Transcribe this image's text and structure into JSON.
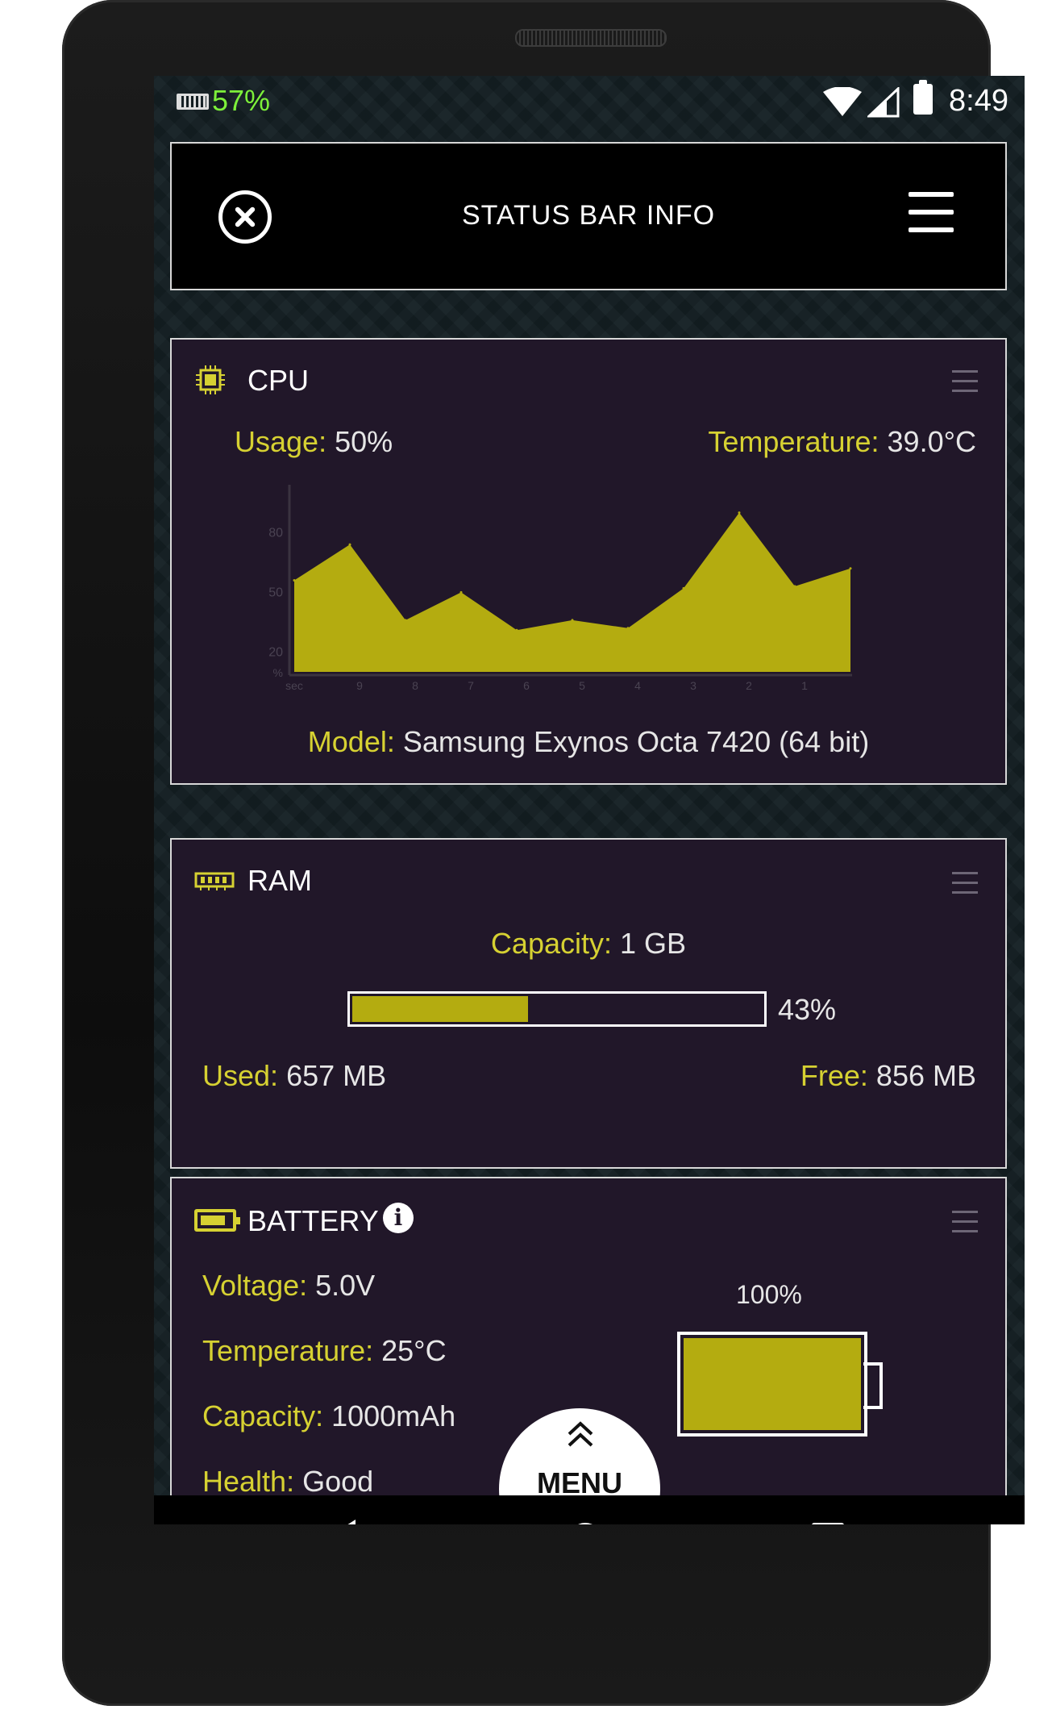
{
  "status_bar": {
    "ram_percent": "57%",
    "time": "8:49",
    "icons": [
      "ram-icon",
      "wifi-icon",
      "signal-icon",
      "battery-icon"
    ]
  },
  "app_bar": {
    "title": "STATUS BAR INFO",
    "close_icon": "close-circle-icon",
    "menu_icon": "hamburger-menu-icon"
  },
  "cpu": {
    "title": "CPU",
    "usage_label": "Usage:",
    "usage_value": "50%",
    "temperature_label": "Temperature:",
    "temperature_value": "39.0°C",
    "model_label": "Model:",
    "model_value": "Samsung Exynos Octa 7420 (64 bit)"
  },
  "chart_data": {
    "type": "area",
    "x": [
      "sec",
      "9",
      "8",
      "7",
      "6",
      "5",
      "4",
      "3",
      "2",
      "1"
    ],
    "values": [
      56,
      74,
      36,
      50,
      31,
      36,
      32,
      52,
      90,
      53,
      62
    ],
    "ylabel": "%",
    "yticks": [
      "80",
      "50",
      "20"
    ],
    "ylim": [
      10,
      100
    ],
    "colors": {
      "fill": "#b4ac10",
      "axis": "#3a3340"
    }
  },
  "ram": {
    "title": "RAM",
    "capacity_label": "Capacity:",
    "capacity_value": "1 GB",
    "usage_percent": "43%",
    "usage_fraction": 0.43,
    "used_label": "Used:",
    "used_value": "657 MB",
    "free_label": "Free:",
    "free_value": "856 MB"
  },
  "battery": {
    "title": "BATTERY",
    "info_icon_glyph": "i",
    "voltage_label": "Voltage:",
    "voltage_value": "5.0V",
    "temperature_label": "Temperature:",
    "temperature_value": "25°C",
    "capacity_label": "Capacity:",
    "capacity_value": "1000mAh",
    "health_label": "Health:",
    "health_value": "Good",
    "level_percent": "100%",
    "level_fraction": 1.0
  },
  "menu_button": {
    "label": "MENU",
    "icon": "double-chevron-up-icon"
  },
  "nav_bar": {
    "icons": [
      "back-icon",
      "home-icon",
      "recents-icon"
    ]
  },
  "colors": {
    "accent": "#d6d132",
    "fill": "#b4ac10",
    "card_bg": "#211729",
    "ram_status": "#7df03a"
  }
}
